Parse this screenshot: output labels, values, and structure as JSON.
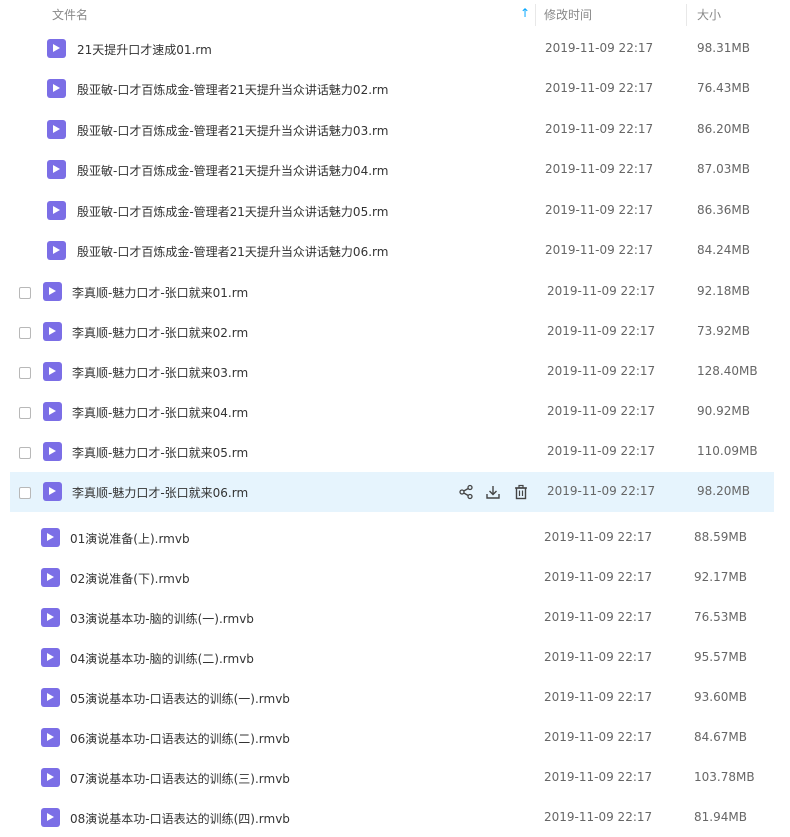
{
  "header": {
    "name_label": "文件名",
    "date_label": "修改时间",
    "size_label": "大小",
    "sort_icon": "sort-up-arrow-icon"
  },
  "files": [
    {
      "name": "21天提升口才速成01.rm",
      "date": "2019-11-09 22:17",
      "size": "98.31MB",
      "icon": "video-file-icon"
    },
    {
      "name": "殷亚敏-口才百炼成金-管理者21天提升当众讲话魅力02.rm",
      "date": "2019-11-09 22:17",
      "size": "76.43MB",
      "icon": "video-file-icon"
    },
    {
      "name": "殷亚敏-口才百炼成金-管理者21天提升当众讲话魅力03.rm",
      "date": "2019-11-09 22:17",
      "size": "86.20MB",
      "icon": "video-file-icon"
    },
    {
      "name": "殷亚敏-口才百炼成金-管理者21天提升当众讲话魅力04.rm",
      "date": "2019-11-09 22:17",
      "size": "87.03MB",
      "icon": "video-file-icon"
    },
    {
      "name": "殷亚敏-口才百炼成金-管理者21天提升当众讲话魅力05.rm",
      "date": "2019-11-09 22:17",
      "size": "86.36MB",
      "icon": "video-file-icon"
    },
    {
      "name": "殷亚敏-口才百炼成金-管理者21天提升当众讲话魅力06.rm",
      "date": "2019-11-09 22:17",
      "size": "84.24MB",
      "icon": "video-file-icon"
    },
    {
      "name": "李真顺-魅力口才-张口就来01.rm",
      "date": "2019-11-09 22:17",
      "size": "92.18MB",
      "icon": "video-file-icon"
    },
    {
      "name": "李真顺-魅力口才-张口就来02.rm",
      "date": "2019-11-09 22:17",
      "size": "73.92MB",
      "icon": "video-file-icon"
    },
    {
      "name": "李真顺-魅力口才-张口就来03.rm",
      "date": "2019-11-09 22:17",
      "size": "128.40MB",
      "icon": "video-file-icon"
    },
    {
      "name": "李真顺-魅力口才-张口就来04.rm",
      "date": "2019-11-09 22:17",
      "size": "90.92MB",
      "icon": "video-file-icon"
    },
    {
      "name": "李真顺-魅力口才-张口就来05.rm",
      "date": "2019-11-09 22:17",
      "size": "110.09MB",
      "icon": "video-file-icon"
    },
    {
      "name": "李真顺-魅力口才-张口就来06.rm",
      "date": "2019-11-09 22:17",
      "size": "98.20MB",
      "icon": "video-file-icon"
    },
    {
      "name": "01演说准备(上).rmvb",
      "date": "2019-11-09 22:17",
      "size": "88.59MB",
      "icon": "video-file-icon"
    },
    {
      "name": "02演说准备(下).rmvb",
      "date": "2019-11-09 22:17",
      "size": "92.17MB",
      "icon": "video-file-icon"
    },
    {
      "name": "03演说基本功-脑的训练(一).rmvb",
      "date": "2019-11-09 22:17",
      "size": "76.53MB",
      "icon": "video-file-icon"
    },
    {
      "name": "04演说基本功-脑的训练(二).rmvb",
      "date": "2019-11-09 22:17",
      "size": "95.57MB",
      "icon": "video-file-icon"
    },
    {
      "name": "05演说基本功-口语表达的训练(一).rmvb",
      "date": "2019-11-09 22:17",
      "size": "93.60MB",
      "icon": "video-file-icon"
    },
    {
      "name": "06演说基本功-口语表达的训练(二).rmvb",
      "date": "2019-11-09 22:17",
      "size": "84.67MB",
      "icon": "video-file-icon"
    },
    {
      "name": "07演说基本功-口语表达的训练(三).rmvb",
      "date": "2019-11-09 22:17",
      "size": "103.78MB",
      "icon": "video-file-icon"
    },
    {
      "name": "08演说基本功-口语表达的训练(四).rmvb",
      "date": "2019-11-09 22:17",
      "size": "81.94MB",
      "icon": "video-file-icon"
    }
  ],
  "row_actions": {
    "share_icon": "share-icon",
    "download_icon": "download-icon",
    "delete_icon": "trash-icon"
  },
  "colors": {
    "accent": "#06a7ff",
    "file_icon": "#7b6ee6",
    "hover_row": "#e6f4fd"
  }
}
